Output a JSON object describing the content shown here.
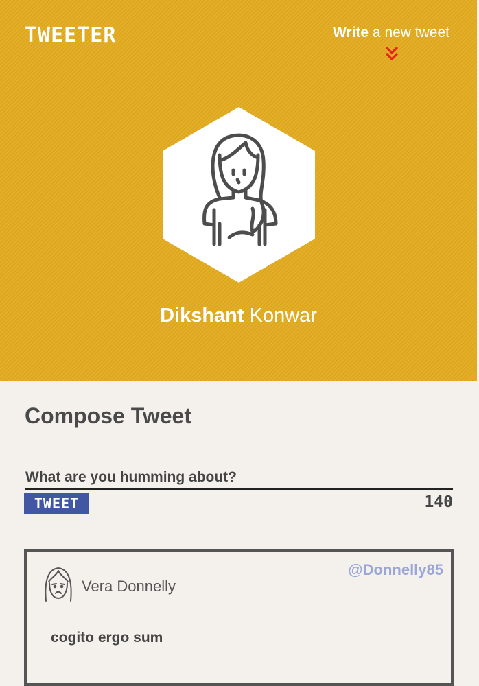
{
  "header": {
    "brand": "TWEETER",
    "compose_link_bold": "Write",
    "compose_link_rest": " a new tweet",
    "compose_link_icon": "chevron-double-down-icon",
    "accent_color": "#e3ac1f",
    "chevron_color": "#e8251d"
  },
  "profile": {
    "avatar_icon": "woman-avatar-icon",
    "first_name": "Dikshant",
    "last_name": " Konwar"
  },
  "compose": {
    "title": "Compose Tweet",
    "placeholder": "What are you humming about?",
    "value": "",
    "button_label": "TWEET",
    "counter": "140",
    "button_color": "#4157a3"
  },
  "tweets": [
    {
      "avatar_icon": "sad-woman-avatar-icon",
      "name": "Vera Donnelly",
      "handle": "@Donnelly85",
      "text": "cogito ergo sum"
    }
  ]
}
